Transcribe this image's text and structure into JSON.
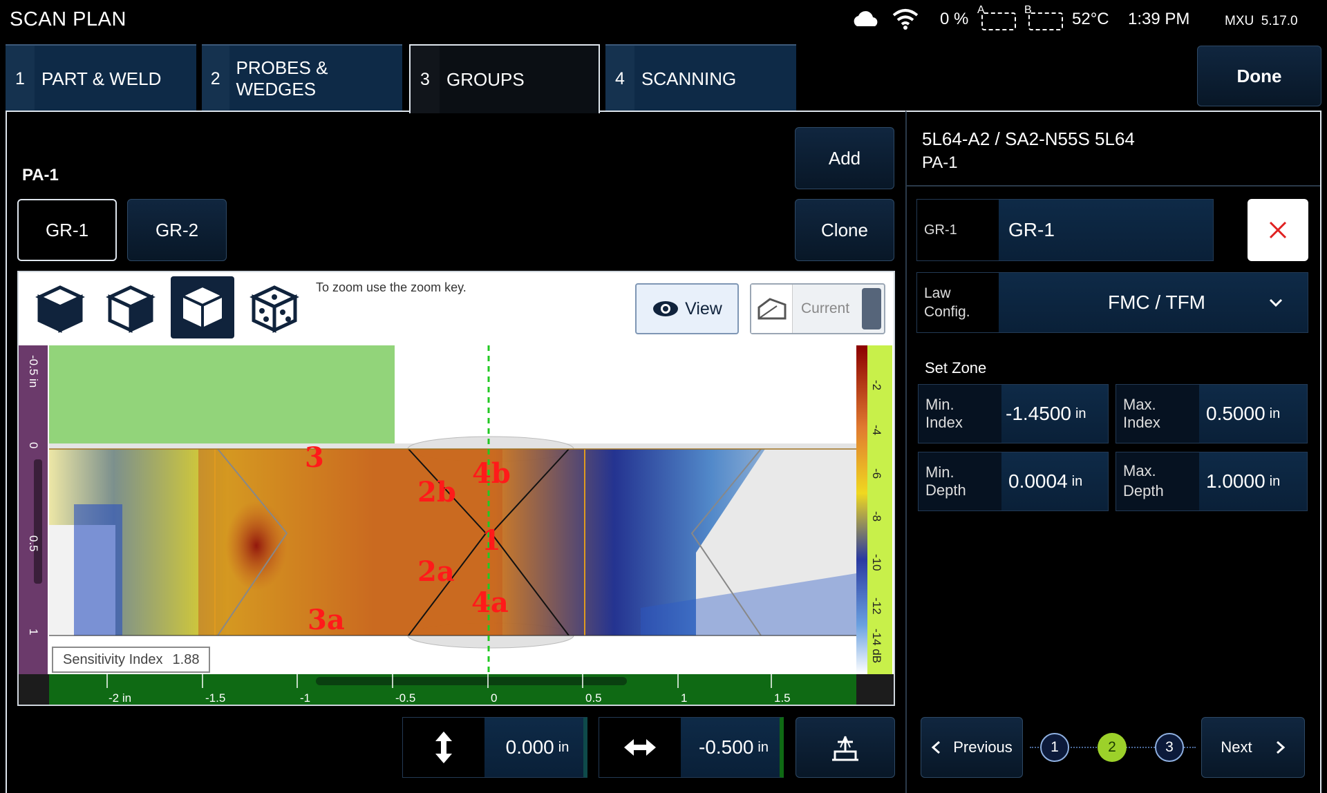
{
  "header": {
    "title": "SCAN PLAN",
    "battery": "0 %",
    "slot_a": "A",
    "slot_b": "B",
    "temperature": "52°C",
    "time": "1:39 PM",
    "version": "MXU  5.17.0"
  },
  "tabs": [
    {
      "num": "1",
      "label": "PART & WELD"
    },
    {
      "num": "2",
      "label": "PROBES & WEDGES"
    },
    {
      "num": "3",
      "label": "GROUPS"
    },
    {
      "num": "4",
      "label": "SCANNING"
    }
  ],
  "done_label": "Done",
  "left": {
    "pa_label": "PA-1",
    "groups": [
      "GR-1",
      "GR-2"
    ],
    "add_label": "Add",
    "clone_label": "Clone",
    "zoom_hint": "To zoom use the zoom key.",
    "view_label": "View",
    "current_label": "Current",
    "sensitivity_label": "Sensitivity Index",
    "sensitivity_value": "1.88",
    "x_ticks": [
      "-2 in",
      "-1.5",
      "-1",
      "-0.5",
      "0",
      "0.5",
      "1",
      "1.5"
    ],
    "y_ticks": [
      "-0.5 in",
      "0",
      "0.5",
      "1"
    ],
    "db_ticks": [
      "-2",
      "-4",
      "-6",
      "-8",
      "-10",
      "-12",
      "-14 dB"
    ],
    "annotations": [
      "3",
      "2b",
      "4b",
      "1",
      "2a",
      "4a",
      "3a"
    ],
    "offset_vertical": "0.000",
    "offset_horizontal": "-0.500",
    "unit": "in"
  },
  "right": {
    "probe_title": "5L64-A2 / SA2-N55S 5L64",
    "probe_sub": "PA-1",
    "group_key": "GR-1",
    "group_value": "GR-1",
    "law_key": "Law Config.",
    "law_value": "FMC / TFM",
    "set_zone": "Set Zone",
    "min_index_label": "Min. Index",
    "min_index": "-1.4500",
    "max_index_label": "Max. Index",
    "max_index": "0.5000",
    "min_depth_label": "Min. Depth",
    "min_depth": "0.0004",
    "max_depth_label": "Max. Depth",
    "max_depth": "1.0000",
    "unit": "in",
    "previous_label": "Previous",
    "next_label": "Next",
    "steps": [
      "1",
      "2",
      "3"
    ],
    "active_step": "2"
  },
  "colors": {
    "accent_green": "#9cd12a",
    "tab_bg": "#0e2a47",
    "delete_red": "#e02020"
  }
}
